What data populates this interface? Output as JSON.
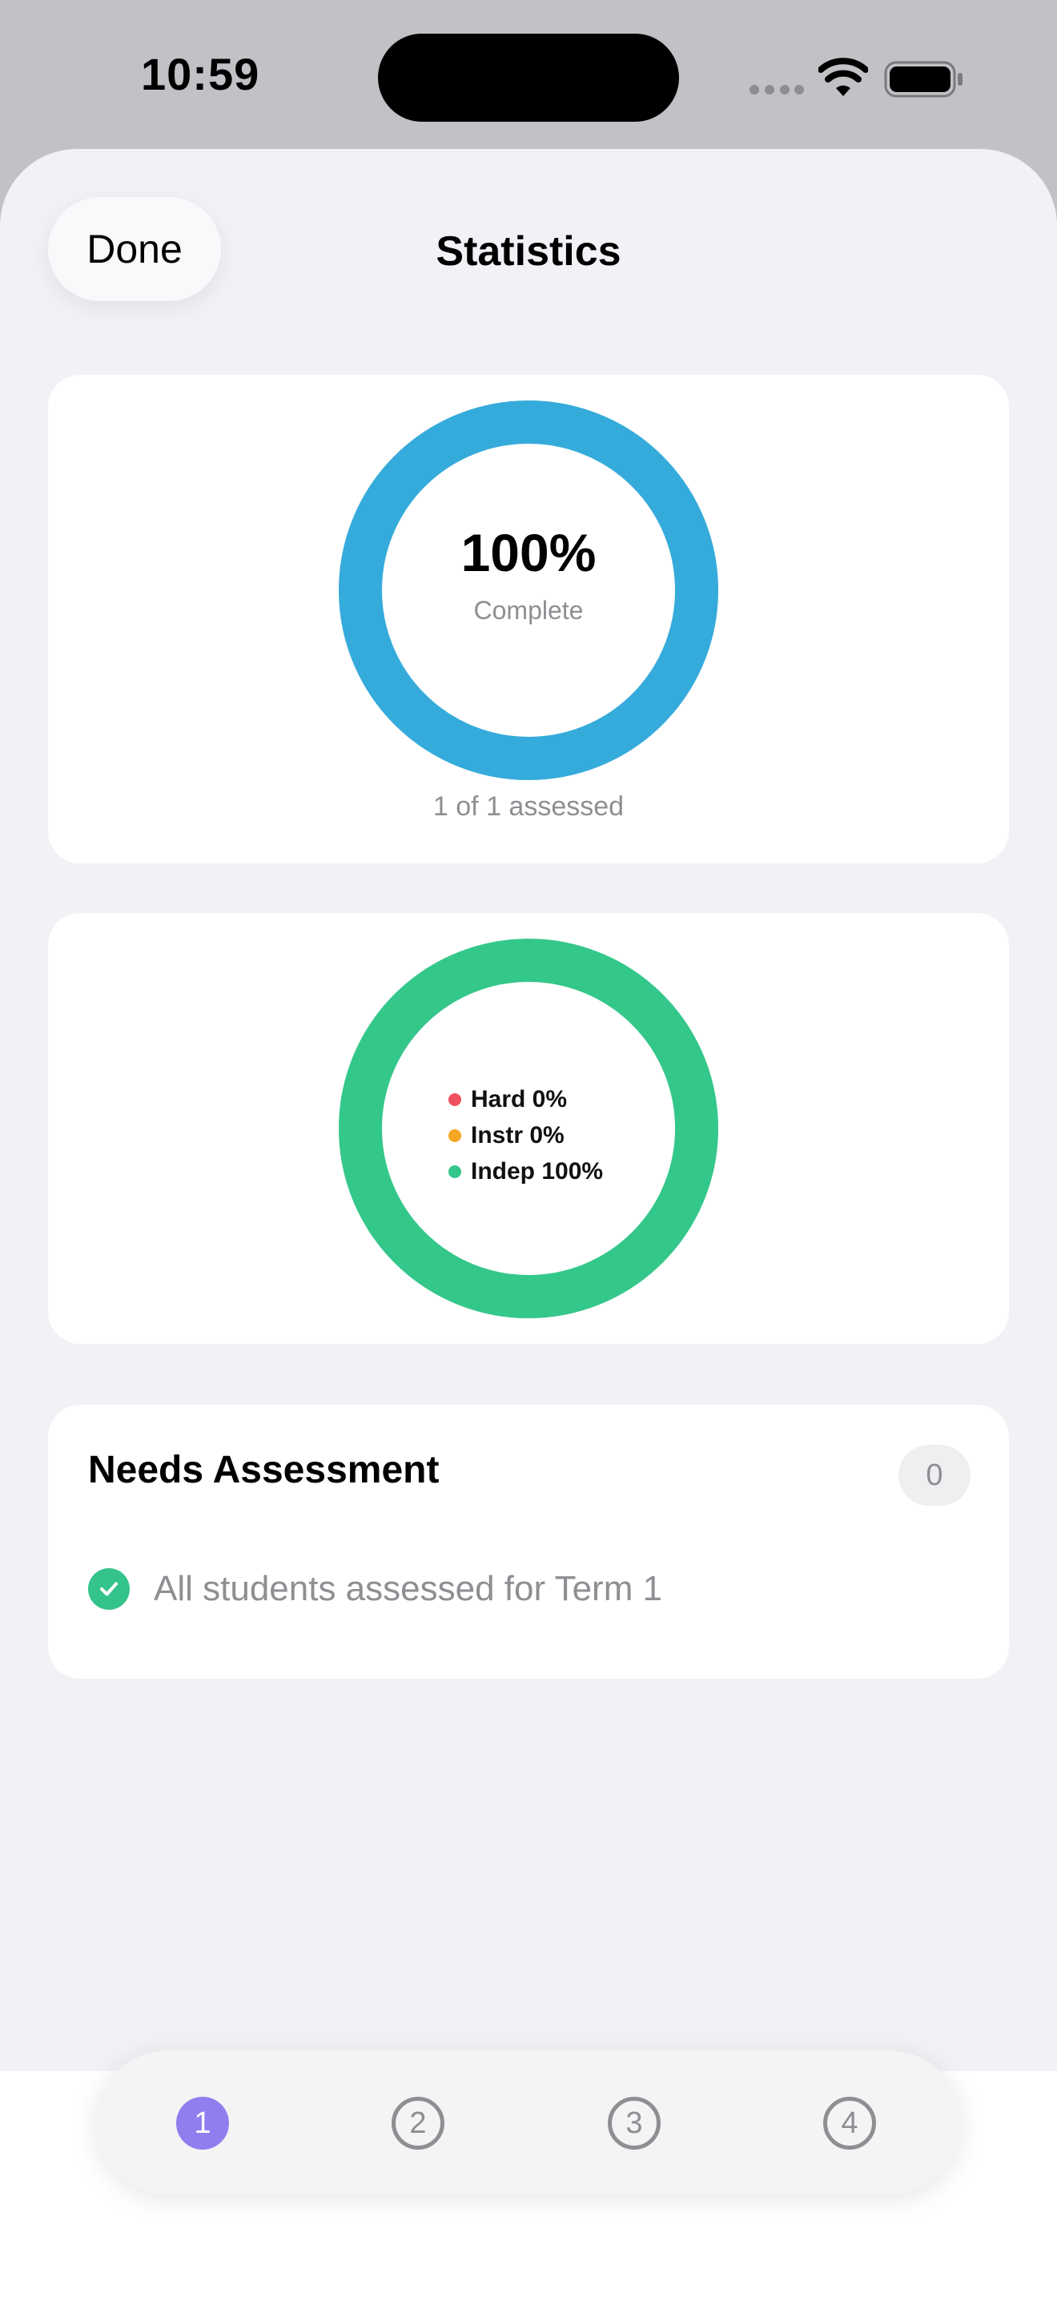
{
  "status_bar": {
    "time": "10:59",
    "icons": [
      "cellular-dots-icon",
      "wifi-icon",
      "battery-icon"
    ]
  },
  "header": {
    "done_label": "Done",
    "title": "Statistics"
  },
  "progress_card": {
    "percent_label": "100%",
    "percent_value": 100,
    "caption": "Complete",
    "assessed_text": "1 of 1 assessed",
    "ring_color": "#35abdb"
  },
  "levels_card": {
    "ring_color": "#34c78a",
    "legend": [
      {
        "label": "Hard 0%",
        "value": 0,
        "color": "#f0505e"
      },
      {
        "label": "Instr 0%",
        "value": 0,
        "color": "#f5a623"
      },
      {
        "label": "Indep 100%",
        "value": 100,
        "color": "#34c78a"
      }
    ]
  },
  "needs_assessment": {
    "title": "Needs Assessment",
    "count": "0",
    "message": "All students assessed for Term 1",
    "icon": "checkmark-circle-icon",
    "icon_color": "#34c38a"
  },
  "tabs": [
    {
      "label": "1",
      "active": true
    },
    {
      "label": "2",
      "active": false
    },
    {
      "label": "3",
      "active": false
    },
    {
      "label": "4",
      "active": false
    }
  ],
  "colors": {
    "accent": "#8f7eed",
    "background": "#f2f1f6"
  }
}
